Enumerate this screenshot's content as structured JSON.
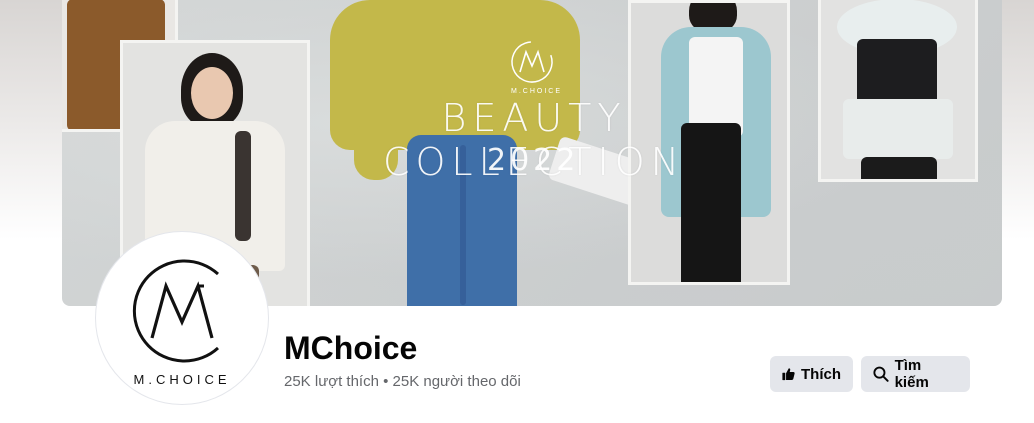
{
  "cover": {
    "headline": "BEAUTY COLLECTION",
    "year": "2022",
    "brand_mark": "M.CHOICE"
  },
  "page": {
    "name": "MChoice",
    "stats": "25K lượt thích • 25K người theo dõi",
    "avatar_text": "M.CHOICE"
  },
  "actions": {
    "like_label": "Thích",
    "search_label": "Tìm kiếm"
  },
  "colors": {
    "button_bg": "#e4e6eb",
    "secondary_text": "#65676b",
    "primary_text": "#050505"
  },
  "icons": {
    "like": "thumbs-up-icon",
    "search": "search-icon"
  }
}
